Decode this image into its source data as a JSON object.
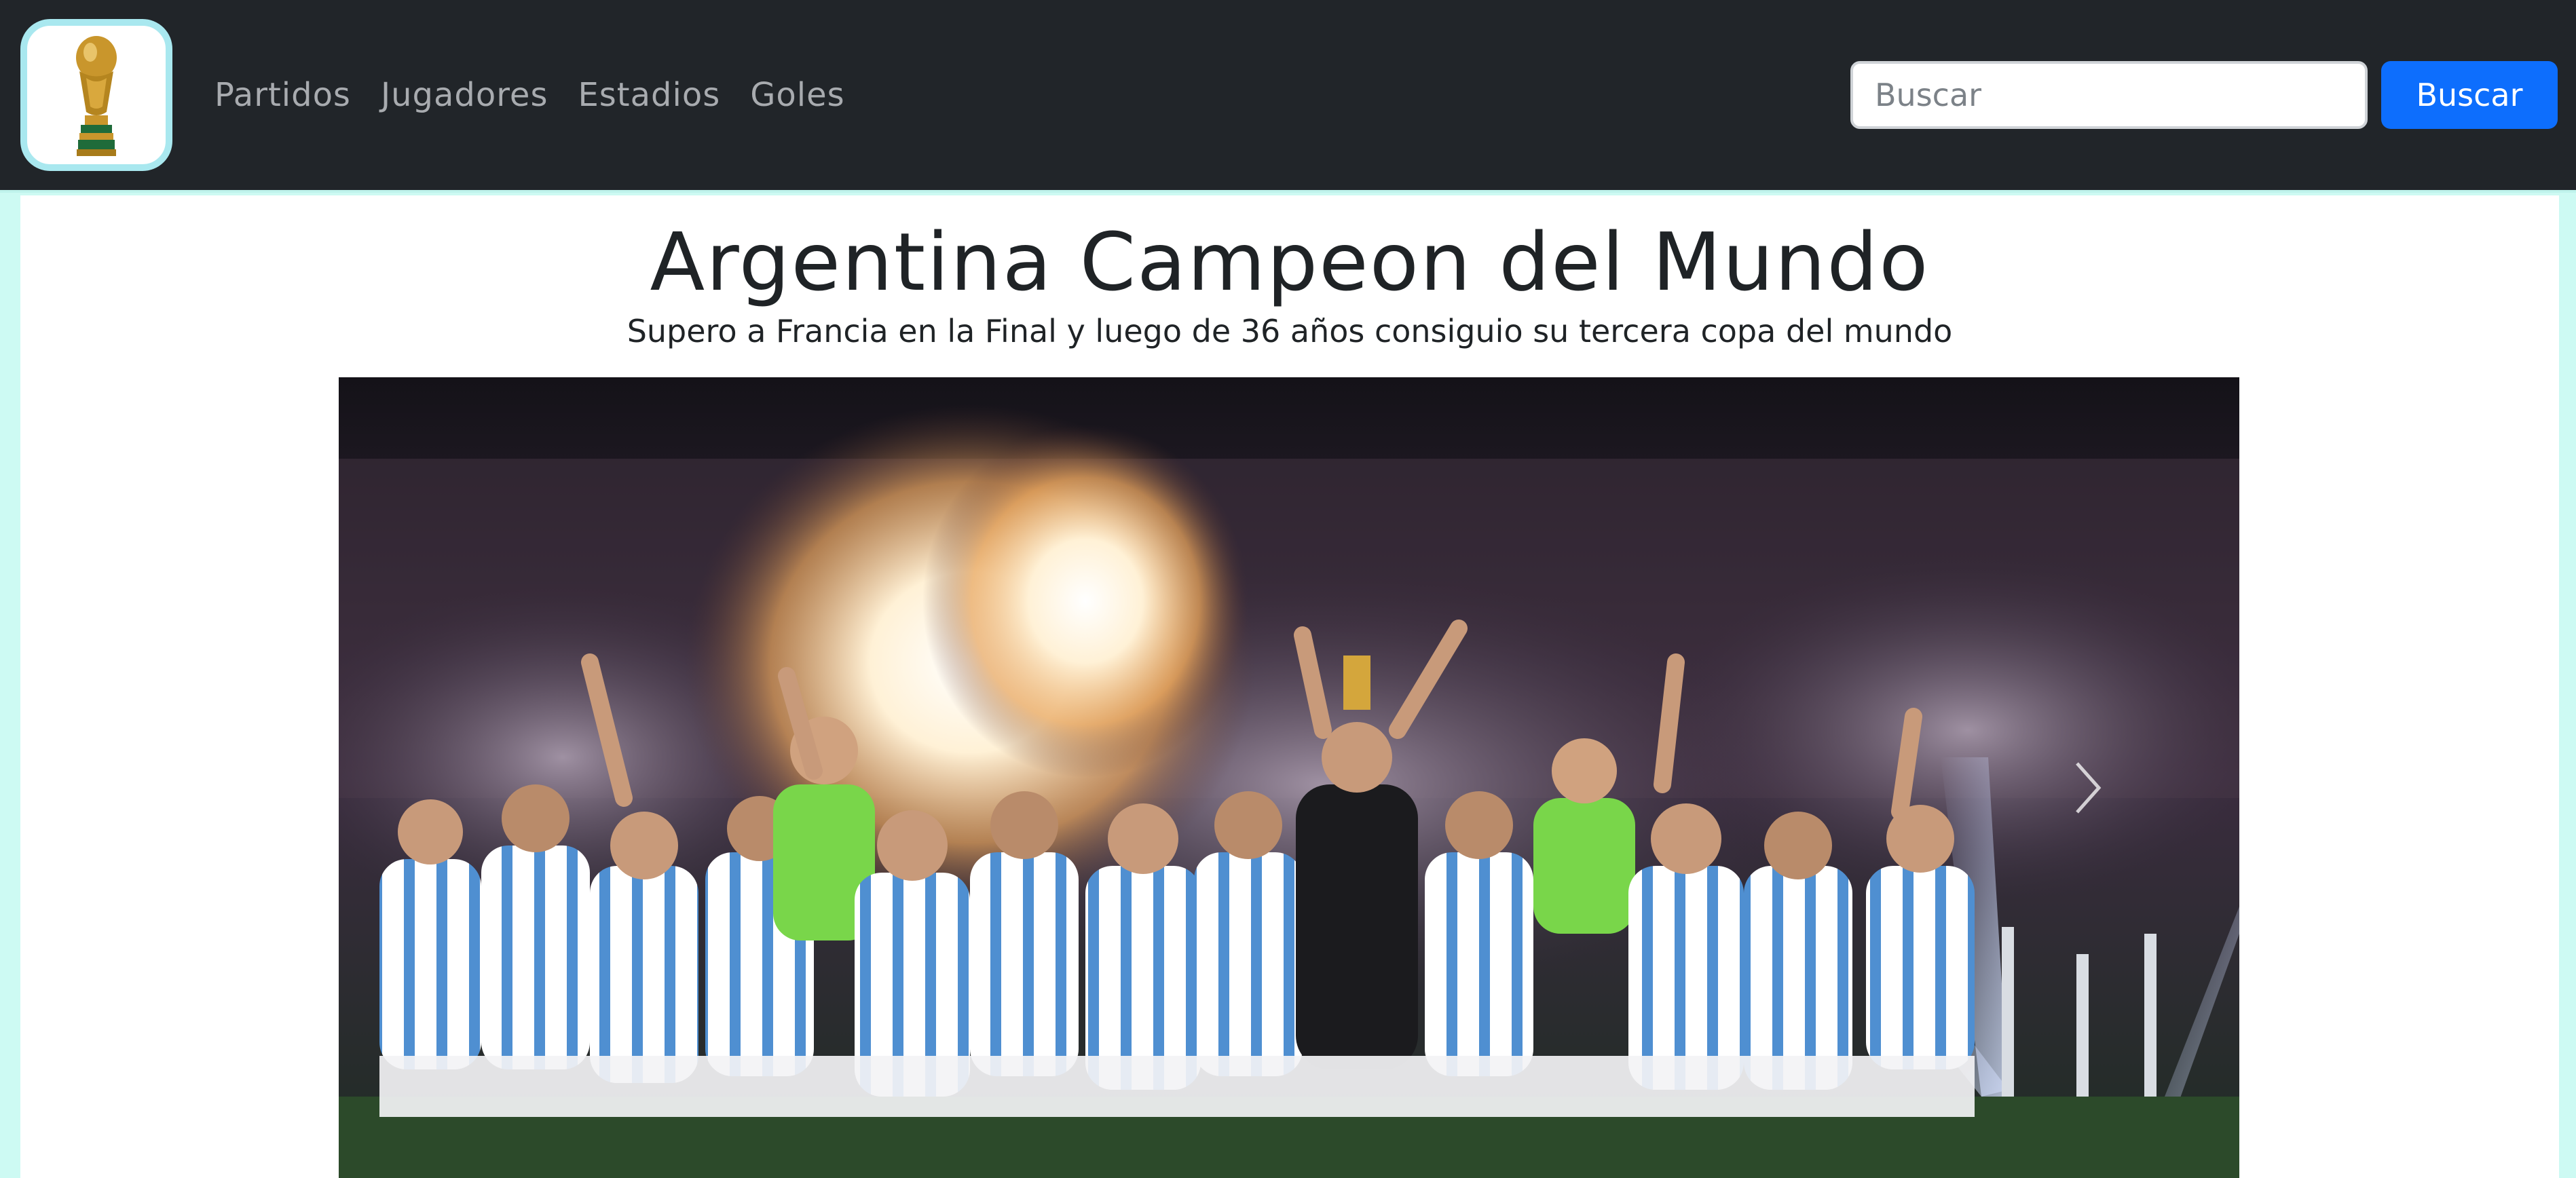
{
  "navbar": {
    "logo_icon": "world-cup-trophy-icon",
    "links": [
      "Partidos",
      "Jugadores",
      "Estadios",
      "Goles"
    ],
    "search": {
      "placeholder": "Buscar",
      "value": "",
      "button_label": "Buscar"
    }
  },
  "hero": {
    "title": "Argentina Campeon del Mundo",
    "subtitle": "Supero a Francia en la Final y luego de 36 años consiguio su tercera copa del mundo"
  },
  "carousel": {
    "image_icon": "team-celebration-photo",
    "next_icon": "chevron-right-icon"
  },
  "colors": {
    "navbar_bg": "#212529",
    "page_bg": "#cdfaf3",
    "accent": "#0d6efd",
    "logo_border": "#a9e8ef"
  }
}
